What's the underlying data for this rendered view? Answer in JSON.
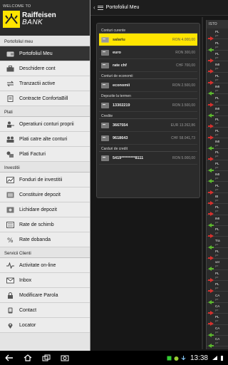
{
  "brand": {
    "welcome": "WELCOME TO",
    "name_line1": "Raiffeisen",
    "name_line2": "BANK"
  },
  "drawer": {
    "sections": [
      {
        "title": "Portofoliul meu",
        "items": [
          {
            "label": "Portofoliul Meu",
            "icon": "wallet-icon",
            "active": true
          },
          {
            "label": "Deschidere cont",
            "icon": "briefcase-icon"
          },
          {
            "label": "Tranzactii active",
            "icon": "transfer-icon"
          },
          {
            "label": "Contracte ConfortaBill",
            "icon": "contract-icon"
          }
        ]
      },
      {
        "title": "Plati",
        "items": [
          {
            "label": "Operatiuni conturi proprii",
            "icon": "person-transfer-icon"
          },
          {
            "label": "Plati catre alte conturi",
            "icon": "persons-transfer-icon"
          },
          {
            "label": "Plati Facturi",
            "icon": "bill-icon"
          }
        ]
      },
      {
        "title": "Investitii",
        "items": [
          {
            "label": "Fonduri de investitii",
            "icon": "chart-icon"
          },
          {
            "label": "Constituire depozit",
            "icon": "deposit-icon"
          },
          {
            "label": "Lichidare depozit",
            "icon": "withdraw-icon"
          },
          {
            "label": "Rate de schimb",
            "icon": "exchange-icon"
          },
          {
            "label": "Rate dobanda",
            "icon": "percent-icon"
          }
        ]
      },
      {
        "title": "Servicii Clienti",
        "items": [
          {
            "label": "Activitate on-line",
            "icon": "activity-icon"
          },
          {
            "label": "Inbox",
            "icon": "envelope-icon"
          },
          {
            "label": "Modificare Parola",
            "icon": "lock-icon"
          },
          {
            "label": "Contact",
            "icon": "phone-icon"
          },
          {
            "label": "Locator",
            "icon": "pin-icon"
          }
        ]
      }
    ]
  },
  "header": {
    "title": "Portofoliul Meu"
  },
  "accounts": {
    "groups": [
      {
        "title": "Conturi curente",
        "items": [
          {
            "name": "salariu",
            "balance": "RON 4.000,00",
            "selected": true
          },
          {
            "name": "euro",
            "balance": "RON 300,00"
          },
          {
            "name": "rate chf",
            "balance": "CHF 700,00"
          }
        ]
      },
      {
        "title": "Conturi de economii",
        "items": [
          {
            "name": "economii",
            "balance": "RON 2.500,00"
          }
        ]
      },
      {
        "title": "Depozite la termen",
        "items": [
          {
            "name": "13302219",
            "balance": "RON 3.500,00"
          }
        ]
      },
      {
        "title": "Credite",
        "items": [
          {
            "name": "3667554",
            "balance": "EUR 13.262,86"
          },
          {
            "name": "9618643",
            "balance": "CHF 58.041,73"
          }
        ]
      },
      {
        "title": "Carduri de credit",
        "items": [
          {
            "name": "5419*********8111",
            "balance": "RON 5.000,00"
          }
        ]
      }
    ]
  },
  "transactions": {
    "header": "ISTO",
    "rows": [
      {
        "dir": "out",
        "t1": "PL",
        "t2": "pe"
      },
      {
        "dir": "in",
        "t1": "PL",
        "t2": "pe"
      },
      {
        "dir": "out",
        "t1": "PL",
        "t2": "pe"
      },
      {
        "dir": "out",
        "t1": "IMI",
        "t2": "pe"
      },
      {
        "dir": "out",
        "t1": "PL",
        "t2": "pe"
      },
      {
        "dir": "in",
        "t1": "IMI",
        "t2": "pe"
      },
      {
        "dir": "out",
        "t1": "PL",
        "t2": "pe"
      },
      {
        "dir": "in",
        "t1": "IMI",
        "t2": "pe"
      },
      {
        "dir": "out",
        "t1": "PL",
        "t2": "pe"
      },
      {
        "dir": "out",
        "t1": "PL",
        "t2": "pe"
      },
      {
        "dir": "in",
        "t1": "IMI",
        "t2": "pe"
      },
      {
        "dir": "out",
        "t1": "PL",
        "t2": "pe"
      },
      {
        "dir": "in",
        "t1": "PL",
        "t2": "pe"
      },
      {
        "dir": "in",
        "t1": "IMI",
        "t2": "pe"
      },
      {
        "dir": "out",
        "t1": "PL",
        "t2": "pe"
      },
      {
        "dir": "out",
        "t1": "IB",
        "t2": "pe"
      },
      {
        "dir": "out",
        "t1": "PL",
        "t2": "pe"
      },
      {
        "dir": "in",
        "t1": "IMI",
        "t2": "pe"
      },
      {
        "dir": "out",
        "t1": "PL",
        "t2": "pe"
      },
      {
        "dir": "in",
        "t1": "Tra",
        "t2": "pe"
      },
      {
        "dir": "out",
        "t1": "PL",
        "t2": "pe"
      },
      {
        "dir": "in",
        "t1": "ver",
        "t2": "pe"
      },
      {
        "dir": "out",
        "t1": "PL",
        "t2": "pe"
      },
      {
        "dir": "out",
        "t1": "PL",
        "t2": "pe"
      },
      {
        "dir": "in",
        "t1": "CA",
        "t2": "pe"
      },
      {
        "dir": "out",
        "t1": "CA",
        "t2": "pe"
      },
      {
        "dir": "out",
        "t1": "PL",
        "t2": "pe"
      },
      {
        "dir": "in",
        "t1": "CA",
        "t2": "pe"
      },
      {
        "dir": "in",
        "t1": "CA",
        "t2": "pe"
      }
    ]
  },
  "system_bar": {
    "time": "13:38"
  },
  "colors": {
    "accent": "#ffe500",
    "out_arrow": "#d8312e",
    "in_arrow": "#5cb82e"
  }
}
